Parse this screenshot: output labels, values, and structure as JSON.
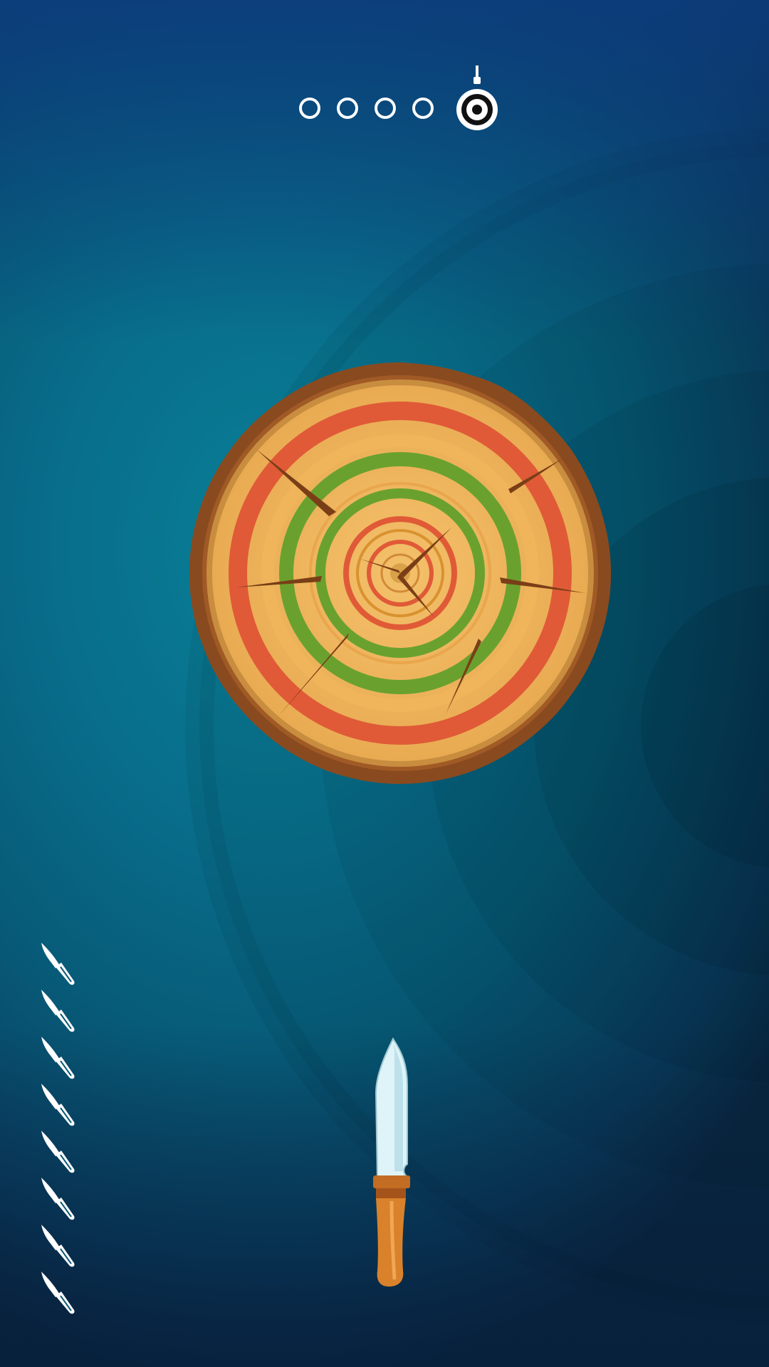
{
  "stage": {
    "completed_count": 0,
    "total_regular_stages": 4,
    "boss_icon": "target-boss-icon"
  },
  "target": {
    "type": "wooden-log",
    "colors": {
      "bark": "#8a4a1f",
      "wood": "#f0b45a",
      "ring_red": "#e05a37",
      "ring_green": "#6aa12e",
      "rim": "#c98d3f"
    },
    "stuck_knives_count": 7
  },
  "knives_remaining": 8,
  "player_knife": {
    "blade_color": "#dff4f8",
    "handle_color": "#d9822b"
  },
  "colors": {
    "background_top": "#0b3a78",
    "background_mid": "#087f98",
    "background_bottom": "#0a2a45",
    "ui_white": "#ffffff"
  }
}
